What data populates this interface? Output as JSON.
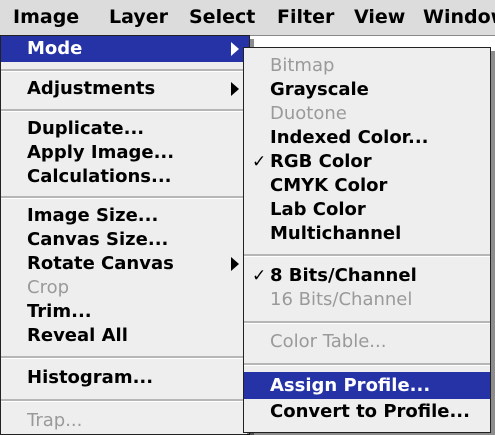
{
  "menubar": {
    "items": [
      {
        "label": "Image",
        "active": true
      },
      {
        "label": "Layer",
        "active": false
      },
      {
        "label": "Select",
        "active": false
      },
      {
        "label": "Filter",
        "active": false
      },
      {
        "label": "View",
        "active": false
      },
      {
        "label": "Window",
        "active": false
      }
    ]
  },
  "image_menu": {
    "items": [
      {
        "label": "Mode",
        "state": "highlighted",
        "submenu": true
      },
      {
        "label": "Adjustments",
        "state": "enabled",
        "submenu": true
      },
      {
        "label": "Duplicate...",
        "state": "enabled",
        "submenu": false
      },
      {
        "label": "Apply Image...",
        "state": "enabled",
        "submenu": false
      },
      {
        "label": "Calculations...",
        "state": "enabled",
        "submenu": false
      },
      {
        "label": "Image Size...",
        "state": "enabled",
        "submenu": false
      },
      {
        "label": "Canvas Size...",
        "state": "enabled",
        "submenu": false
      },
      {
        "label": "Rotate Canvas",
        "state": "enabled",
        "submenu": true
      },
      {
        "label": "Crop",
        "state": "disabled",
        "submenu": false
      },
      {
        "label": "Trim...",
        "state": "enabled",
        "submenu": false
      },
      {
        "label": "Reveal All",
        "state": "enabled",
        "submenu": false
      },
      {
        "label": "Histogram...",
        "state": "enabled",
        "submenu": false
      },
      {
        "label": "Trap...",
        "state": "disabled",
        "submenu": false
      }
    ]
  },
  "mode_menu": {
    "items": [
      {
        "label": "Bitmap",
        "state": "disabled",
        "checked": false
      },
      {
        "label": "Grayscale",
        "state": "enabled",
        "checked": false
      },
      {
        "label": "Duotone",
        "state": "disabled",
        "checked": false
      },
      {
        "label": "Indexed Color...",
        "state": "enabled",
        "checked": false
      },
      {
        "label": "RGB Color",
        "state": "enabled",
        "checked": true
      },
      {
        "label": "CMYK Color",
        "state": "enabled",
        "checked": false
      },
      {
        "label": "Lab Color",
        "state": "enabled",
        "checked": false
      },
      {
        "label": "Multichannel",
        "state": "enabled",
        "checked": false
      },
      {
        "label": "8 Bits/Channel",
        "state": "enabled",
        "checked": true
      },
      {
        "label": "16 Bits/Channel",
        "state": "disabled",
        "checked": false
      },
      {
        "label": "Color Table...",
        "state": "disabled",
        "checked": false
      },
      {
        "label": "Assign Profile...",
        "state": "highlighted",
        "checked": false
      },
      {
        "label": "Convert to Profile...",
        "state": "enabled",
        "checked": false
      }
    ]
  },
  "check_glyph": "✓",
  "colors": {
    "highlight": "#2533a6",
    "menu_bg": "#eeeeee",
    "menubar_bg": "#dcdcdc",
    "disabled_text": "#9a9a9a"
  }
}
